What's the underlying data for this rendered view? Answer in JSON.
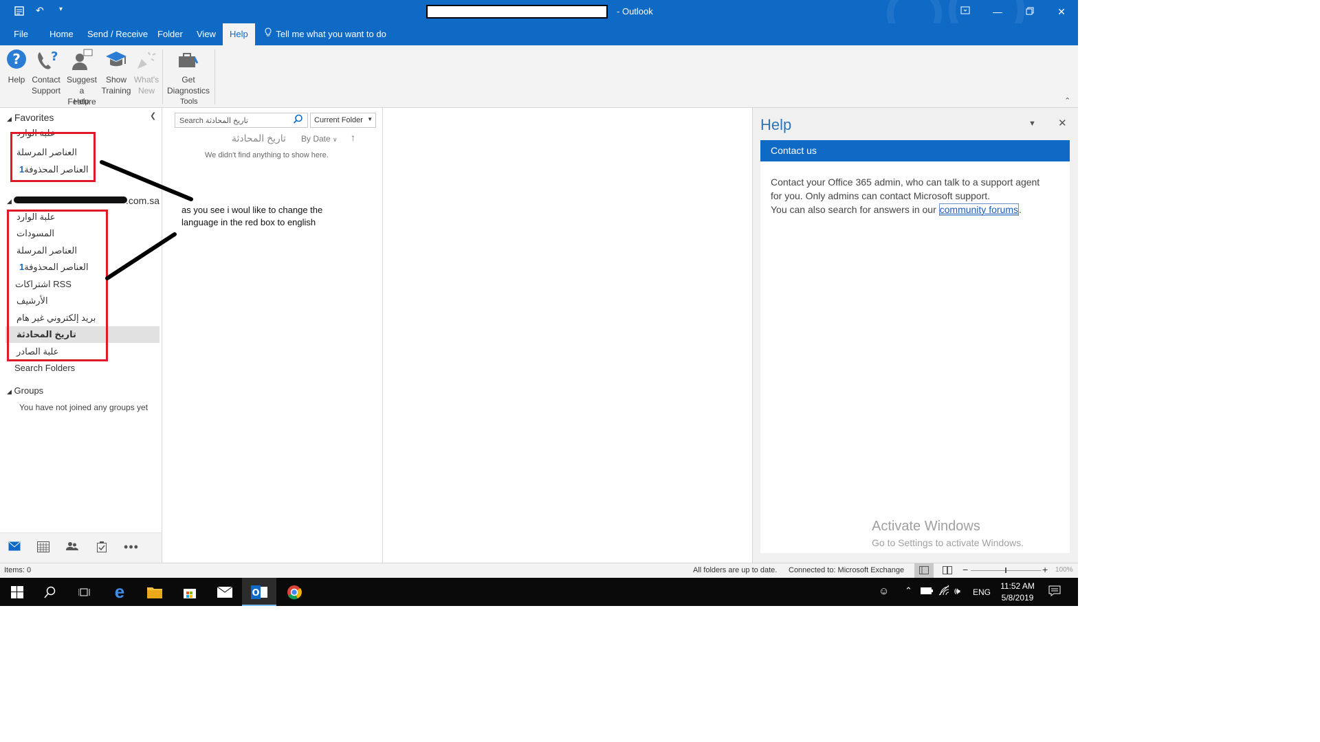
{
  "window": {
    "title": "Outlook",
    "title_prefix": "- ",
    "window_controls": [
      "restore-icon",
      "minimize-icon",
      "maximize-icon",
      "close-icon"
    ]
  },
  "tabs": [
    {
      "label": "File"
    },
    {
      "label": "Home"
    },
    {
      "label": "Send / Receive"
    },
    {
      "label": "Folder"
    },
    {
      "label": "View"
    },
    {
      "label": "Help",
      "active": true
    }
  ],
  "tell_me": "Tell me what you want to do",
  "ribbon": {
    "help_group": {
      "label": "Help",
      "buttons": [
        {
          "line1": "Help",
          "line2": "",
          "icon": "help-icon"
        },
        {
          "line1": "Contact",
          "line2": "Support",
          "icon": "contact-support-icon"
        },
        {
          "line1": "Suggest",
          "line2": "a Feature",
          "icon": "suggest-feature-icon"
        },
        {
          "line1": "Show",
          "line2": "Training",
          "icon": "training-icon"
        },
        {
          "line1": "What's",
          "line2": "New",
          "icon": "whats-new-icon",
          "disabled": true
        }
      ]
    },
    "tools_group": {
      "label": "Tools",
      "buttons": [
        {
          "line1": "Get",
          "line2": "Diagnostics",
          "icon": "diagnostics-icon"
        }
      ]
    }
  },
  "nav": {
    "favorites": {
      "header": "Favorites",
      "items": [
        {
          "label": "علبة الوارد",
          "count": ""
        },
        {
          "label": "العناصر المرسلة",
          "count": ""
        },
        {
          "label": "العناصر المحذوفة",
          "count": "1"
        }
      ]
    },
    "account": {
      "email_suffix": ".com.sa",
      "items": [
        {
          "label": "علبة الوارد",
          "count": ""
        },
        {
          "label": "المسودات",
          "count": ""
        },
        {
          "label": "العناصر المرسلة",
          "count": ""
        },
        {
          "label": "العناصر المحذوفة",
          "count": "1"
        },
        {
          "label": "اشتراكات RSS",
          "count": ""
        },
        {
          "label": "الأرشيف",
          "count": ""
        },
        {
          "label": "بريد إلكتروني غير هام",
          "count": ""
        },
        {
          "label": "تاريخ المحادثة",
          "count": "",
          "selected": true
        },
        {
          "label": "علبة الصادر",
          "count": ""
        }
      ],
      "search_folders": "Search Folders"
    },
    "groups": {
      "header": "Groups",
      "empty": "You have not joined any groups yet"
    }
  },
  "message_list": {
    "search_placeholder": "Search تاريخ المحادثة",
    "scope": "Current Folder",
    "folder_title": "تاريخ المحادثة",
    "sort": "By Date",
    "empty_message": "We didn't find anything to show here.",
    "annotation_line1": "as you see i woul like to change the",
    "annotation_line2": "language in the red box to english"
  },
  "help_pane": {
    "title": "Help",
    "section": "Contact us",
    "body_line1": "Contact your Office 365 admin, who can talk to a support agent",
    "body_line2": "for you. Only admins can contact Microsoft support.",
    "body_line3": "You can also search for answers in our",
    "link": "community forums",
    "link_suffix": "."
  },
  "watermark": {
    "title": "Activate Windows",
    "subtitle": "Go to Settings to activate Windows."
  },
  "status": {
    "items": "Items: 0",
    "sync": "All folders are up to date.",
    "connection": "Connected to: Microsoft Exchange",
    "zoom": "100%"
  },
  "taskbar": {
    "language": "ENG",
    "time": "11:52 AM",
    "date": "5/8/2019"
  },
  "colors": {
    "accent": "#0f6ac6",
    "red_box": "#e0192a",
    "count": "#0f6ac6"
  }
}
